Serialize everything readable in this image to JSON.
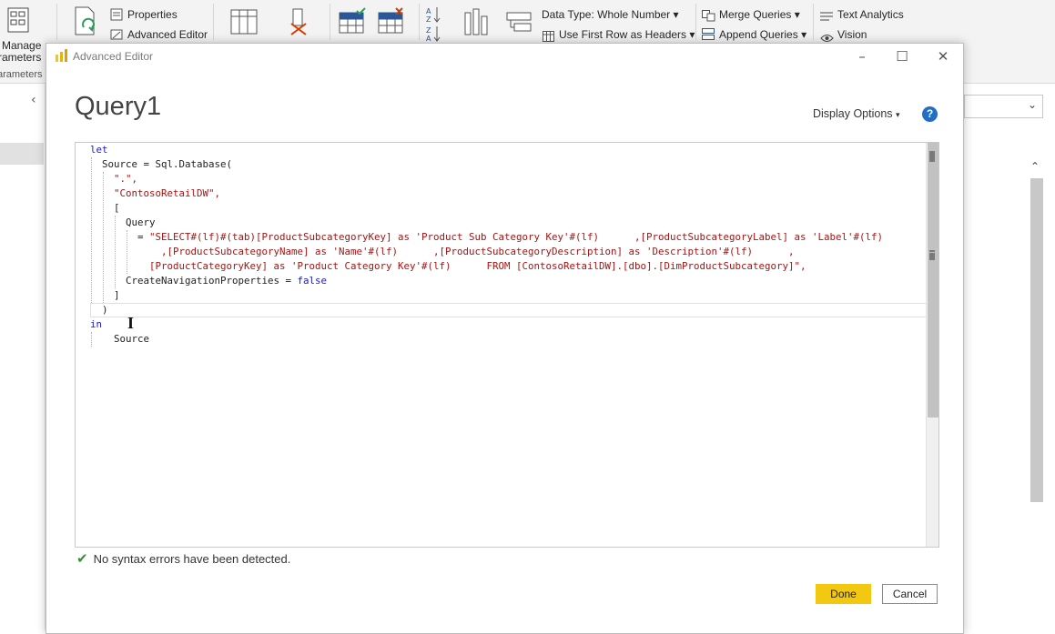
{
  "ribbon": {
    "manage_parameters_line1": "Manage",
    "manage_parameters_line2": "rameters",
    "parameters_group": "arameters",
    "properties": "Properties",
    "advanced_editor": "Advanced Editor",
    "data_type": "Data Type: Whole Number",
    "use_first_row": "Use First Row as Headers",
    "merge_queries": "Merge Queries",
    "append_queries": "Append Queries",
    "text_analytics": "Text Analytics",
    "vision": "Vision"
  },
  "dialog": {
    "window_title": "Advanced Editor",
    "query_name": "Query1",
    "display_options": "Display Options",
    "help_label": "?",
    "status_text": "No syntax errors have been detected.",
    "done_label": "Done",
    "cancel_label": "Cancel"
  },
  "code": {
    "l1": "let",
    "l2": "Source = Sql.Database(",
    "l3": "\".\",",
    "l4": "\"ContosoRetailDW\",",
    "l5": "[",
    "l6": "Query",
    "l7_eq": "= ",
    "l7_str": "\"SELECT#(lf)#(tab)[ProductSubcategoryKey] as 'Product Sub Category Key'#(lf)      ,[ProductSubcategoryLabel] as 'Label'#(lf)",
    "l8_str": ",[ProductSubcategoryName] as 'Name'#(lf)      ,[ProductSubcategoryDescription] as 'Description'#(lf)      ,",
    "l9_str": "[ProductCategoryKey] as 'Product Category Key'#(lf)      FROM [ContosoRetailDW].[dbo].[DimProductSubcategory]\",",
    "l10_name": "CreateNavigationProperties = ",
    "l10_val": "false",
    "l11": "]",
    "l12": ")",
    "l13": "in",
    "l14": "Source"
  }
}
